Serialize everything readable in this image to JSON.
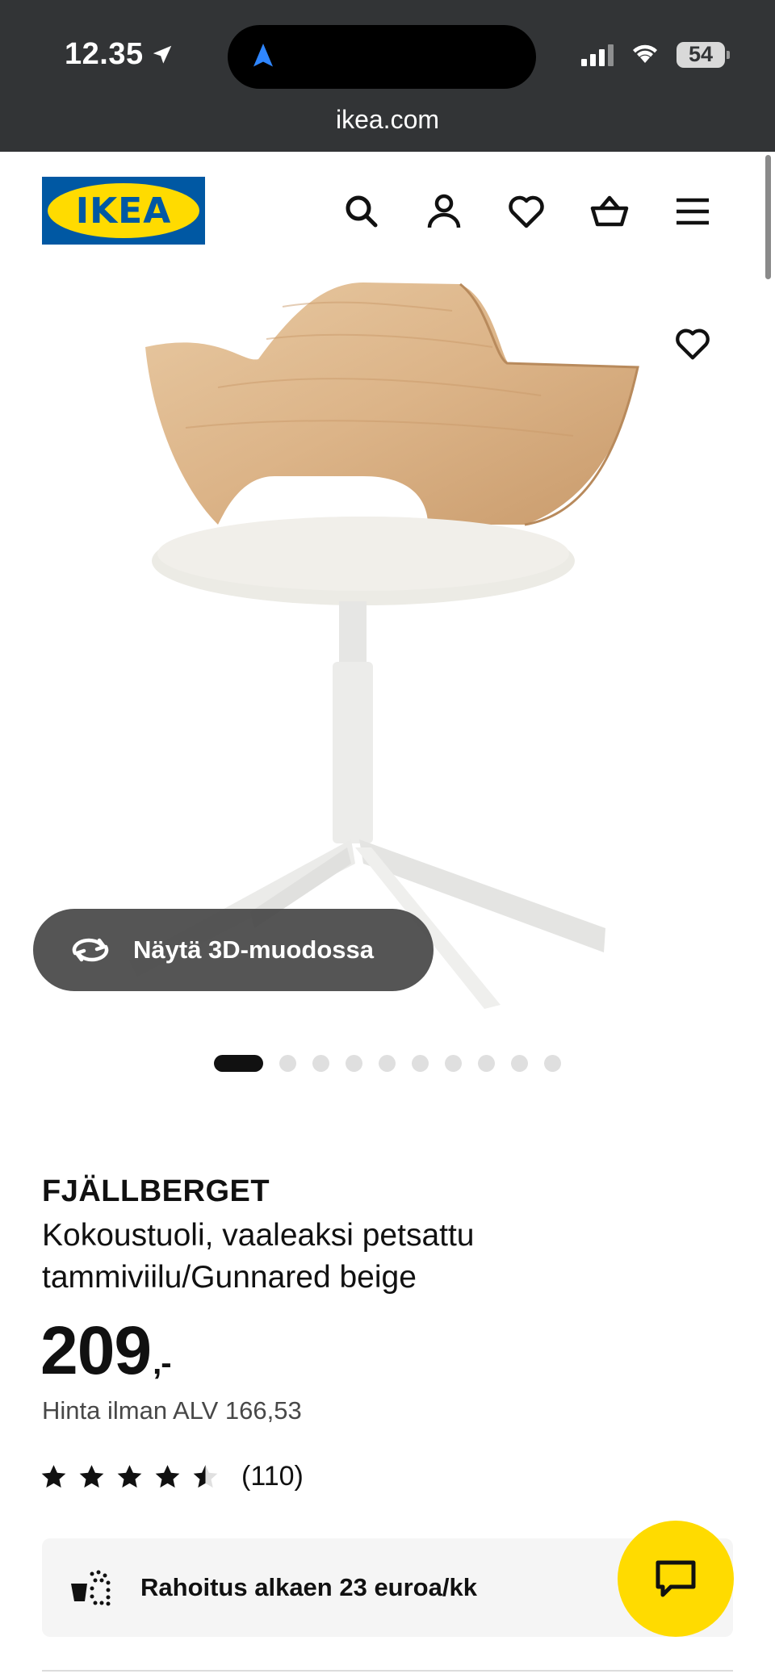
{
  "status_bar": {
    "time": "12.35",
    "battery": "54"
  },
  "browser": {
    "url": "ikea.com"
  },
  "header": {
    "logo_text": "IKEA",
    "icons": [
      "search-icon",
      "user-icon",
      "heart-icon",
      "basket-icon",
      "menu-icon"
    ]
  },
  "gallery": {
    "view_3d_label": "Näytä 3D-muodossa",
    "image_count": 10,
    "active_image_index": 0
  },
  "product": {
    "name": "FJÄLLBERGET",
    "description": "Kokoustuoli, vaaleaksi petsattu tammiviilu/Gunnared beige",
    "price_main": "209",
    "price_suffix": ",-",
    "price_without_vat": "Hinta ilman ALV 166,53",
    "rating_value": 4.5,
    "rating_max": 5,
    "review_count": "(110)"
  },
  "financing": {
    "text": "Rahoitus alkaen 23 euroa/kk"
  },
  "colors": {
    "ikea_blue": "#0058a3",
    "ikea_yellow": "#ffdb00",
    "chrome_dark": "#323436"
  }
}
